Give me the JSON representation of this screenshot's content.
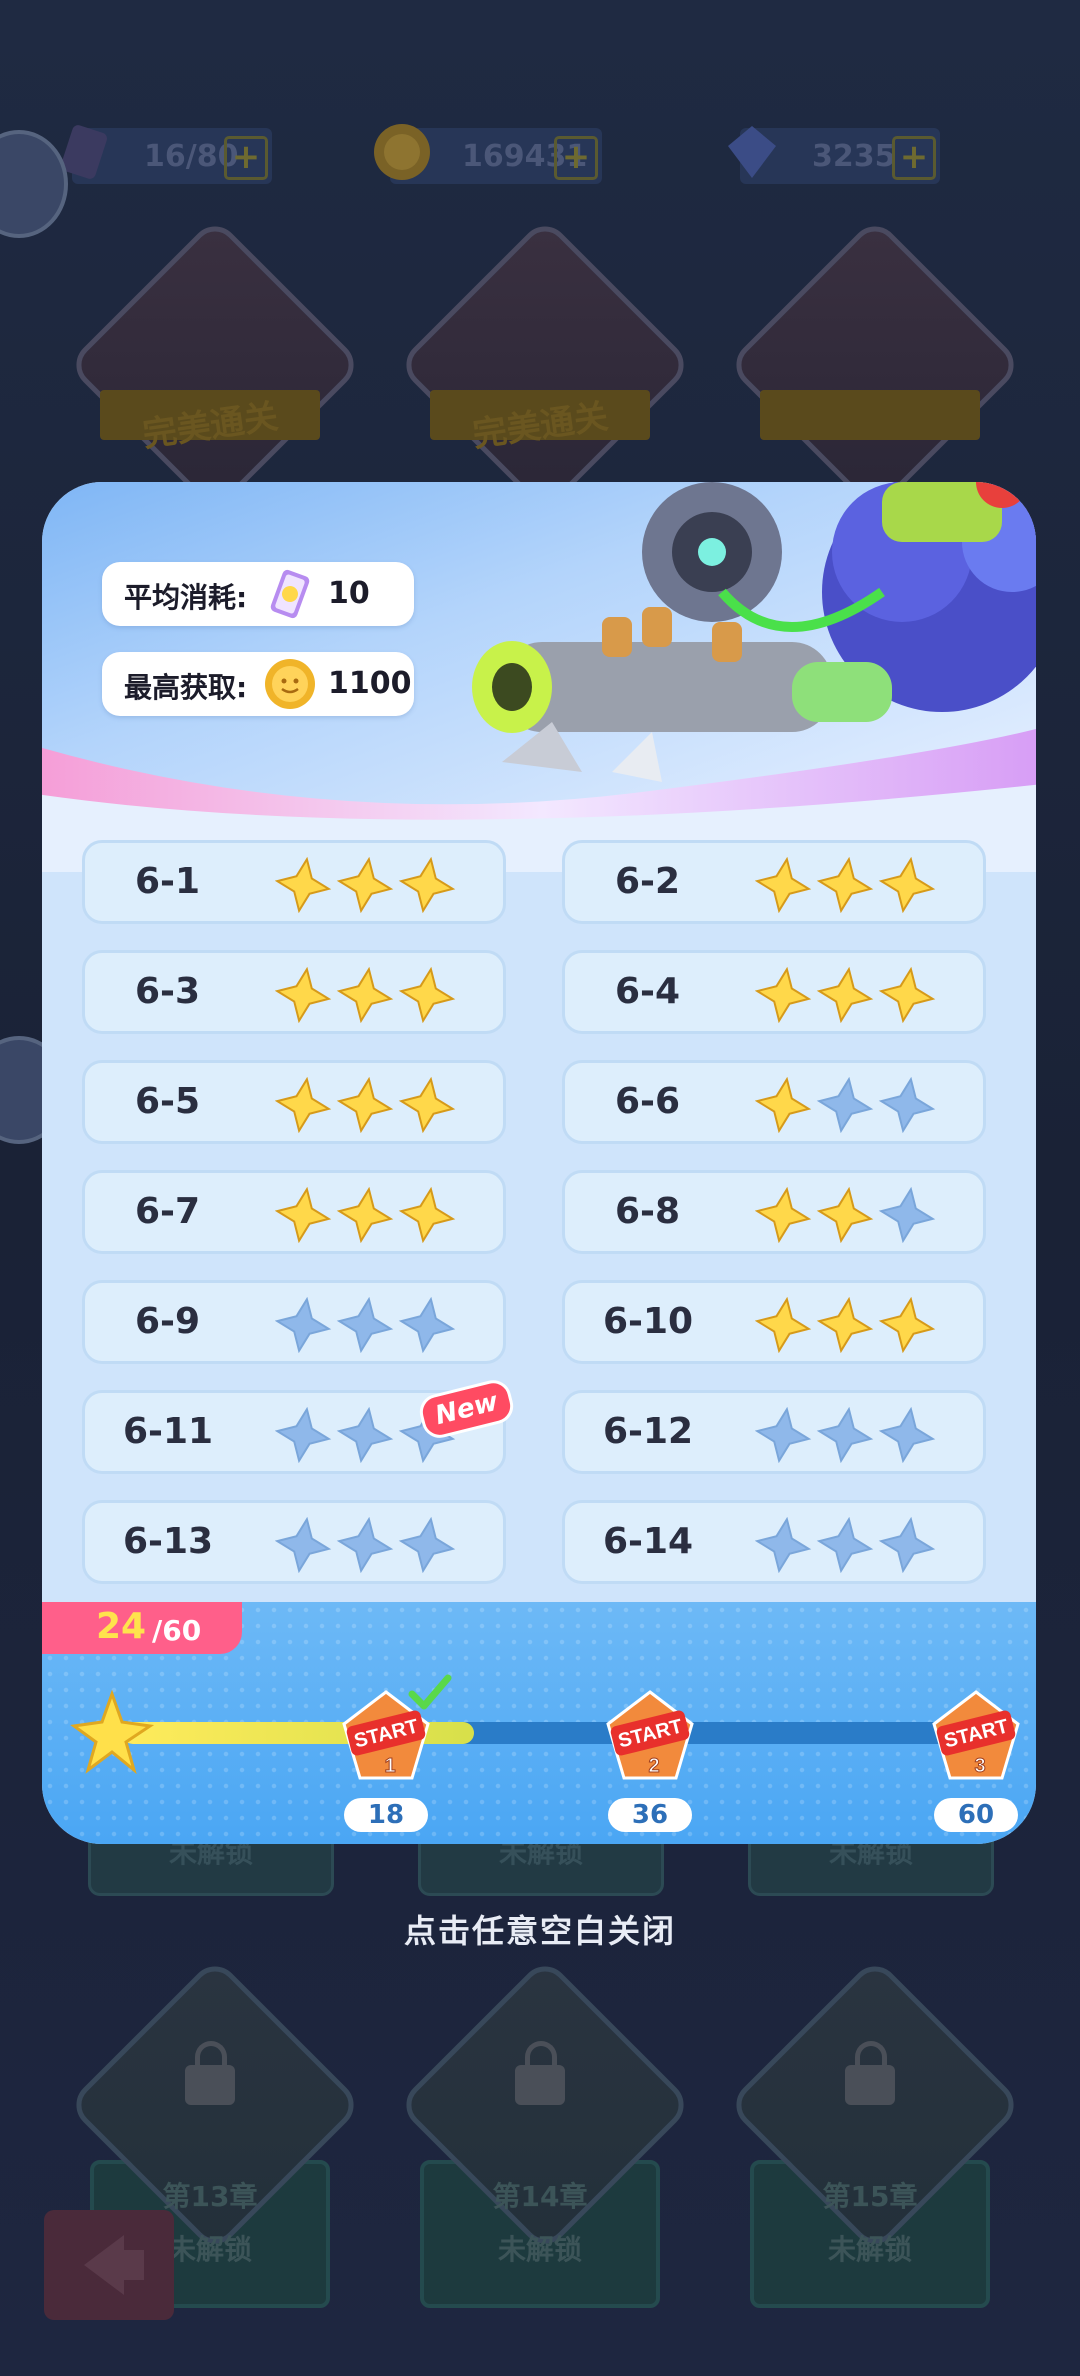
{
  "resources": [
    {
      "name": "ticket",
      "value": "16/80",
      "icon": "ticket-icon"
    },
    {
      "name": "coin",
      "value": "169431",
      "icon": "coin-icon"
    },
    {
      "name": "gem",
      "value": "3235",
      "icon": "gem-icon"
    }
  ],
  "background_chapters": {
    "top_row_badge": "完美通关",
    "locked": [
      {
        "name": "第13章",
        "status": "未解锁"
      },
      {
        "name": "第14章",
        "status": "未解锁"
      },
      {
        "name": "第15章",
        "status": "未解锁"
      }
    ],
    "middle_status": "未解锁"
  },
  "panel": {
    "avg_cost": {
      "label": "平均消耗:",
      "value": "10",
      "icon": "ticket-icon"
    },
    "max_gain": {
      "label": "最高获取:",
      "value": "1100",
      "icon": "coin-icon"
    },
    "levels": [
      {
        "name": "6-1",
        "stars": 3
      },
      {
        "name": "6-2",
        "stars": 3
      },
      {
        "name": "6-3",
        "stars": 3
      },
      {
        "name": "6-4",
        "stars": 3
      },
      {
        "name": "6-5",
        "stars": 3
      },
      {
        "name": "6-6",
        "stars": 1
      },
      {
        "name": "6-7",
        "stars": 3
      },
      {
        "name": "6-8",
        "stars": 2
      },
      {
        "name": "6-9",
        "stars": 0
      },
      {
        "name": "6-10",
        "stars": 3
      },
      {
        "name": "6-11",
        "stars": 0,
        "badge": "New"
      },
      {
        "name": "6-12",
        "stars": 0
      },
      {
        "name": "6-13",
        "stars": 0
      },
      {
        "name": "6-14",
        "stars": 0
      }
    ],
    "progress": {
      "current": "24",
      "total": "/60",
      "current_value": 24,
      "max_value": 60,
      "milestones": [
        {
          "threshold": "18",
          "value": 18,
          "index": "1",
          "claimed": true
        },
        {
          "threshold": "36",
          "value": 36,
          "index": "2",
          "claimed": false
        },
        {
          "threshold": "60",
          "value": 60,
          "index": "3",
          "claimed": false
        }
      ],
      "chest_label": "START"
    }
  },
  "close_hint": "点击任意空白关闭",
  "colors": {
    "star_gold": "#ffd84a",
    "star_empty": "#8fb8ea",
    "accent_pink": "#ff5f8a",
    "progress_blue": "#4aa6f4"
  }
}
